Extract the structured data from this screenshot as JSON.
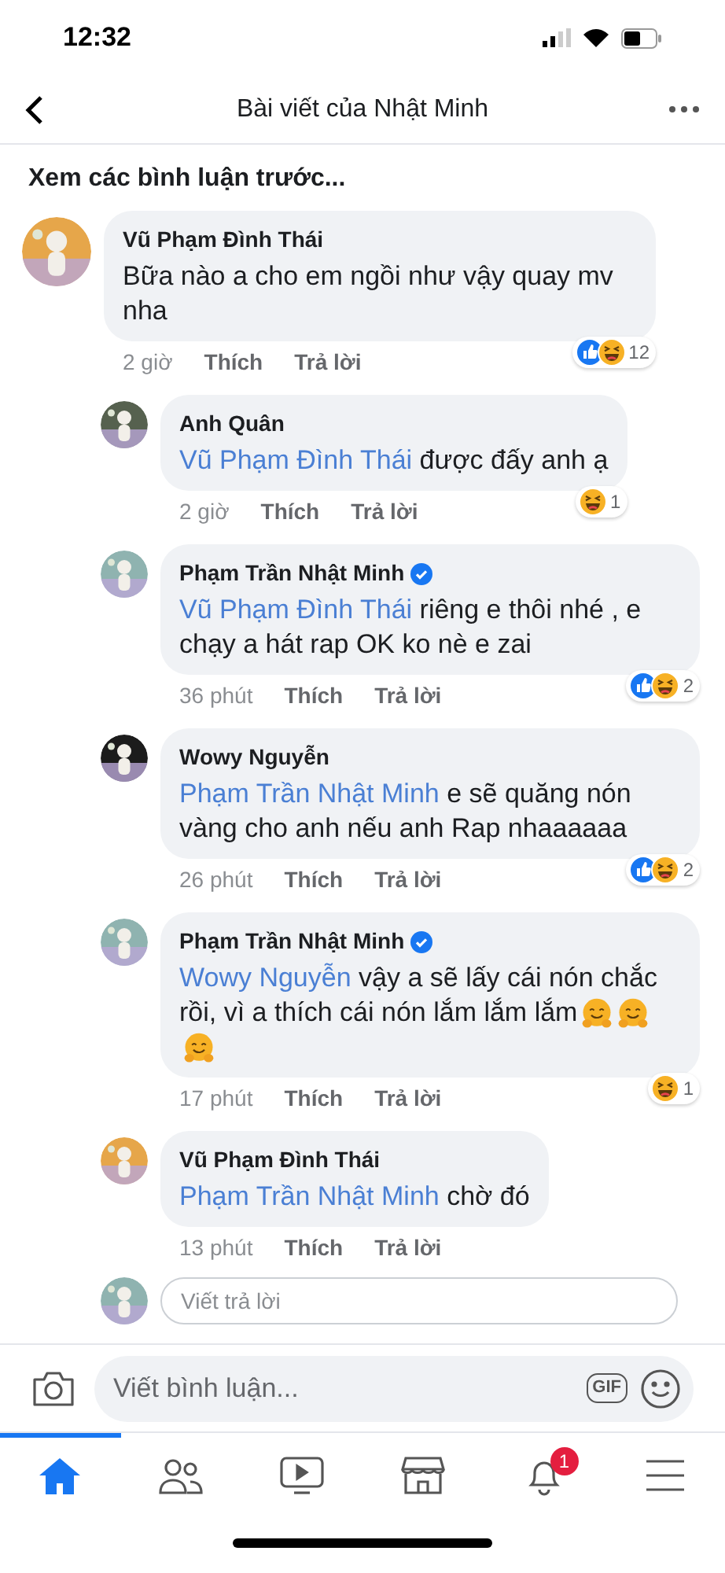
{
  "status_bar": {
    "time": "12:32"
  },
  "header": {
    "title": "Bài viết của Nhật Minh"
  },
  "previous_link": "Xem các bình luận trước...",
  "comments": [
    {
      "author": "Vũ Phạm Đình Thái",
      "verified": false,
      "text": "Bữa nào a cho em ngồi như vậy quay mv nha",
      "time": "2 giờ",
      "actions": [
        "Thích",
        "Trả lời"
      ],
      "reactions": {
        "kinds": [
          {
            "kind": "like"
          },
          {
            "kind": "haha"
          }
        ],
        "count": "12"
      },
      "children": [
        {
          "author": "Anh Quân",
          "verified": false,
          "mention": "Vũ Phạm Đình Thái",
          "text": "được đấy anh ạ",
          "time": "2 giờ",
          "actions": [
            "Thích",
            "Trả lời"
          ],
          "reactions": {
            "kinds": [
              {
                "kind": "haha"
              }
            ],
            "count": "1"
          }
        },
        {
          "author": "Phạm Trần Nhật Minh",
          "verified": true,
          "mention": "Vũ Phạm Đình Thái",
          "text": "riêng e thôi nhé , e chạy a hát rap OK ko nè e zai",
          "time": "36 phút",
          "actions": [
            "Thích",
            "Trả lời"
          ],
          "reactions": {
            "kinds": [
              {
                "kind": "like"
              },
              {
                "kind": "haha"
              }
            ],
            "count": "2"
          }
        },
        {
          "author": "Wowy Nguyễn",
          "verified": false,
          "mention": "Phạm Trần Nhật Minh",
          "text": "e sẽ quăng nón vàng cho anh nếu anh Rap nhaaaaaa",
          "time": "26 phút",
          "actions": [
            "Thích",
            "Trả lời"
          ],
          "reactions": {
            "kinds": [
              {
                "kind": "like"
              },
              {
                "kind": "haha"
              }
            ],
            "count": "2"
          }
        },
        {
          "author": "Phạm Trần Nhật Minh",
          "verified": true,
          "mention": "Wowy Nguyễn",
          "text": "vậy a sẽ lấy cái nón chắc rồi, vì a thích cái nón lắm lắm lắm",
          "emojis": [
            {
              "kind": "hug"
            },
            {
              "kind": "hug"
            },
            {
              "kind": "hug"
            }
          ],
          "time": "17 phút",
          "actions": [
            "Thích",
            "Trả lời"
          ],
          "reactions": {
            "kinds": [
              {
                "kind": "haha"
              }
            ],
            "count": "1"
          }
        },
        {
          "author": "Vũ Phạm Đình Thái",
          "verified": false,
          "mention": "Phạm Trần Nhật Minh",
          "text": "chờ đó",
          "time": "13 phút",
          "actions": [
            "Thích",
            "Trả lời"
          ]
        }
      ],
      "reply_field": {
        "placeholder": "Viết trả lời"
      }
    }
  ],
  "composer": {
    "placeholder": "Viết bình luận...",
    "gif": "GIF"
  },
  "tab_bar": [
    {
      "kind": "home",
      "selected": true
    },
    {
      "kind": "friends",
      "selected": false
    },
    {
      "kind": "watch",
      "selected": false
    },
    {
      "kind": "marketplace",
      "selected": false
    },
    {
      "kind": "notifications",
      "selected": false,
      "badge": "1"
    },
    {
      "kind": "menu",
      "selected": false
    }
  ]
}
